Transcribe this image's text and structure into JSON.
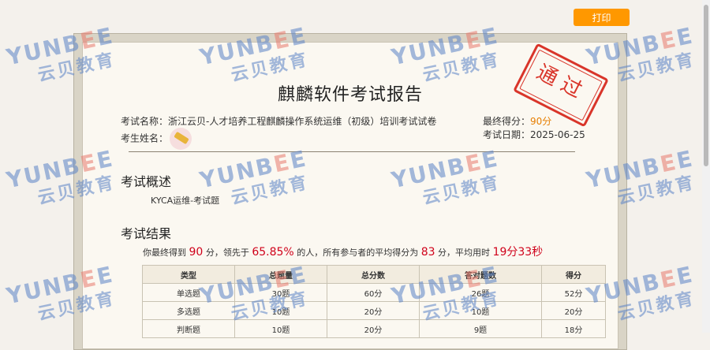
{
  "toolbar": {
    "print_label": "打印"
  },
  "report": {
    "title": "麒麟软件考试报告",
    "exam_name_label": "考试名称：",
    "exam_name": "浙江云贝-人才培养工程麒麟操作系统运维（初级）培训考试试卷",
    "examinee_label": "考生姓名：",
    "final_score_label": "最终得分：",
    "final_score": "90分",
    "exam_date_label": "考试日期：",
    "exam_date": "2025-06-25",
    "stamp_text": "通过"
  },
  "overview": {
    "heading": "考试概述",
    "text": "KYCA运维-考试题"
  },
  "results": {
    "heading": "考试结果",
    "summary": {
      "p1": "你最终得到",
      "score": "90",
      "p2": "分，领先于",
      "percent": "65.85%",
      "p3": "的人，所有参与者的平均得分为",
      "avg": "83",
      "p4": "分，平均用时",
      "time": "19分33秒"
    },
    "table": {
      "headers": [
        "类型",
        "总题量",
        "总分数",
        "答对题数",
        "得分"
      ],
      "rows": [
        [
          "单选题",
          "30题",
          "60分",
          "26题",
          "52分"
        ],
        [
          "多选题",
          "10题",
          "20分",
          "10题",
          "20分"
        ],
        [
          "判断题",
          "10题",
          "20分",
          "9题",
          "18分"
        ]
      ]
    }
  },
  "watermark": {
    "en_pre": "YUNB",
    "en_e1": "E",
    "en_e2": "E",
    "cn": "云贝教育"
  },
  "colors": {
    "accent": "#ff9800",
    "score": "#e67e00",
    "stamp": "#d9352a",
    "highlight": "#d0021b"
  }
}
